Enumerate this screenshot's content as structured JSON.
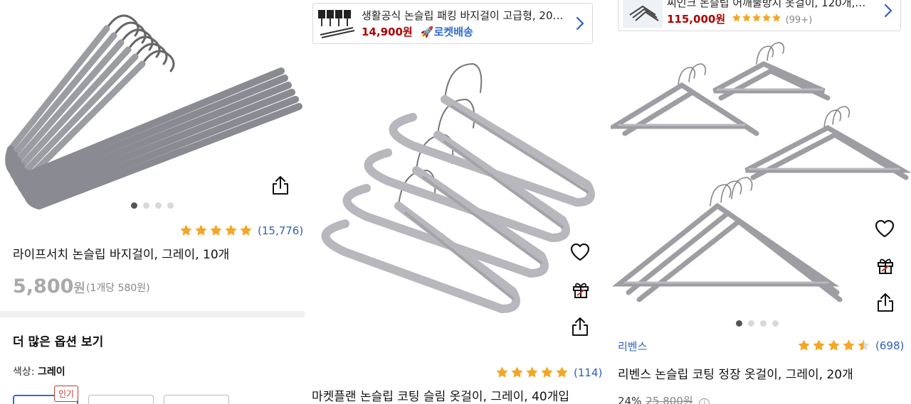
{
  "panel1": {
    "rating": {
      "stars": 5,
      "count": "(15,776)"
    },
    "title": "라이프서치 논슬립 바지걸이, 그레이, 10개",
    "price": "5,800",
    "price_unit": "원",
    "unit_price": "(1개당 580원)",
    "more_options": "더 많은 옵션 보기",
    "color_label": "색상: ",
    "color_value": "그레이",
    "popular_badge": "인기",
    "carousel": {
      "count": 4,
      "active": 0
    }
  },
  "panel2": {
    "banner": {
      "title": "생활공식 논슬립 패킹 바지걸이 고급형, 20…",
      "price": "14,900원",
      "delivery": "로켓배송"
    },
    "rating": {
      "stars": 5,
      "count": "(114)"
    },
    "title": "마켓플랜 논슬립 코팅 슬림 옷걸이, 그레이, 40개입"
  },
  "panel3": {
    "banner": {
      "title": "씨인크 논슬립 어깨뿔방지 옷걸이, 120개,…",
      "price": "115,000원",
      "rating_count": "(99+)"
    },
    "brand": "리벤스",
    "rating": {
      "stars": 4.5,
      "count": "(698)"
    },
    "title": "리벤스 논슬립 코팅 정장 옷걸이, 그레이, 20개",
    "discount": "24%",
    "original_price": "25,800원",
    "carousel": {
      "count": 4,
      "active": 0
    }
  },
  "colors": {
    "star": "#f5a623",
    "link": "#2f5fb8",
    "price_red": "#ae0000",
    "rocket_blue": "#2f6bd8"
  },
  "icons": [
    "share-icon",
    "heart-icon",
    "gift-icon",
    "chevron-right-icon",
    "star-icon",
    "info-icon",
    "rocket-icon"
  ]
}
